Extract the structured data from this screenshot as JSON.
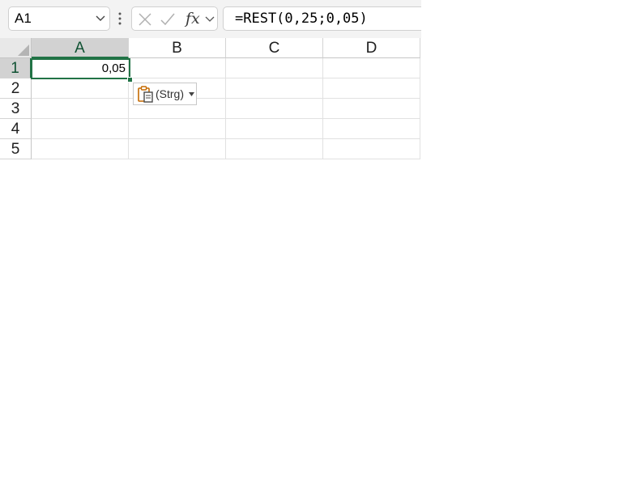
{
  "name_box": {
    "value": "A1"
  },
  "formula_bar": {
    "fx_label": "fx",
    "formula": "=REST(0,25;0,05)"
  },
  "grid": {
    "columns": [
      "A",
      "B",
      "C",
      "D"
    ],
    "rows": [
      "1",
      "2",
      "3",
      "4",
      "5"
    ],
    "active_cell": "A1",
    "cells": {
      "A1": "0,05"
    }
  },
  "paste_options": {
    "label": "(Strg)"
  },
  "colors": {
    "accent": "#217346",
    "header_selected_bg": "#d2d2d2",
    "paste_icon": "#c56a00"
  }
}
